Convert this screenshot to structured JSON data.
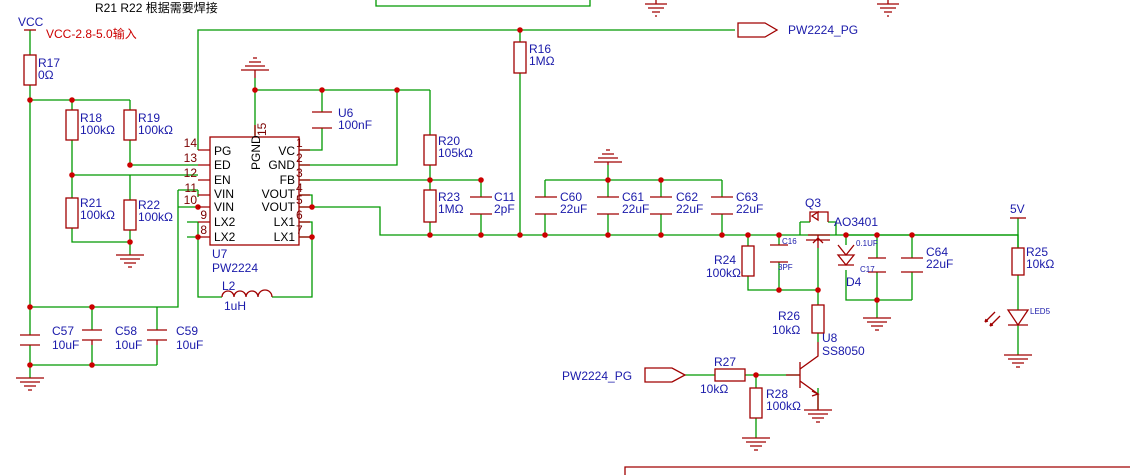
{
  "title_note": "R21 R22 根据需要焊接",
  "power": {
    "vcc": "VCC",
    "vcc_note": "VCC-2.8-5.0输入",
    "v5": "5V"
  },
  "netlabels": {
    "pg_out": "PW2224_PG",
    "pg_in": "PW2224_PG"
  },
  "ic": {
    "ref": "U7",
    "part": "PW2224",
    "pgnd": "PGND",
    "pin15": "15",
    "left_pins": [
      {
        "num": "14",
        "name": "PG"
      },
      {
        "num": "13",
        "name": "ED"
      },
      {
        "num": "12",
        "name": "EN"
      },
      {
        "num": "11",
        "name": "VIN"
      },
      {
        "num": "10",
        "name": "VIN"
      },
      {
        "num": "9",
        "name": "LX2"
      },
      {
        "num": "8",
        "name": "LX2"
      }
    ],
    "right_pins": [
      {
        "num": "1",
        "name": "VC"
      },
      {
        "num": "2",
        "name": "GND"
      },
      {
        "num": "3",
        "name": "FB"
      },
      {
        "num": "4",
        "name": "VOUT"
      },
      {
        "num": "5",
        "name": "VOUT"
      },
      {
        "num": "6",
        "name": "LX1"
      },
      {
        "num": "7",
        "name": "LX1"
      }
    ]
  },
  "parts": {
    "R17": {
      "ref": "R17",
      "val": "0Ω"
    },
    "R18": {
      "ref": "R18",
      "val": "100kΩ"
    },
    "R19": {
      "ref": "R19",
      "val": "100kΩ"
    },
    "R21": {
      "ref": "R21",
      "val": "100kΩ"
    },
    "R22": {
      "ref": "R22",
      "val": "100kΩ"
    },
    "U6": {
      "ref": "U6",
      "val": "100nF"
    },
    "R16": {
      "ref": "R16",
      "val": "1MΩ"
    },
    "R20": {
      "ref": "R20",
      "val": "105kΩ"
    },
    "R23": {
      "ref": "R23",
      "val": "1MΩ"
    },
    "C11": {
      "ref": "C11",
      "val": "2pF"
    },
    "C60": {
      "ref": "C60",
      "val": "22uF"
    },
    "C61": {
      "ref": "C61",
      "val": "22uF"
    },
    "C62": {
      "ref": "C62",
      "val": "22uF"
    },
    "C63": {
      "ref": "C63",
      "val": "22uF"
    },
    "L2": {
      "ref": "L2",
      "val": "1uH"
    },
    "C57": {
      "ref": "C57",
      "val": "10uF"
    },
    "C58": {
      "ref": "C58",
      "val": "10uF"
    },
    "C59": {
      "ref": "C59",
      "val": "10uF"
    },
    "Q3": {
      "ref": "Q3",
      "val": "AO3401"
    },
    "C16": {
      "ref": "C16",
      "val": "3PF"
    },
    "C17": {
      "ref": "C17",
      "val": "0.1UF"
    },
    "D4": {
      "ref": "D4"
    },
    "C64": {
      "ref": "C64",
      "val": "22uF"
    },
    "R24": {
      "ref": "R24",
      "val": "100kΩ"
    },
    "R25": {
      "ref": "R25",
      "val": "10kΩ"
    },
    "LED5": {
      "ref": "LED5"
    },
    "R26": {
      "ref": "R26",
      "val": "10kΩ"
    },
    "U8": {
      "ref": "U8",
      "val": "SS8050"
    },
    "R27": {
      "ref": "R27",
      "val": "10kΩ"
    },
    "R28": {
      "ref": "R28",
      "val": "100kΩ"
    }
  },
  "colors": {
    "wire": "#009900",
    "symbol": "#a00000",
    "label": "#1a1aaa",
    "note_red": "#cc0000",
    "junction": "#cc0000"
  }
}
